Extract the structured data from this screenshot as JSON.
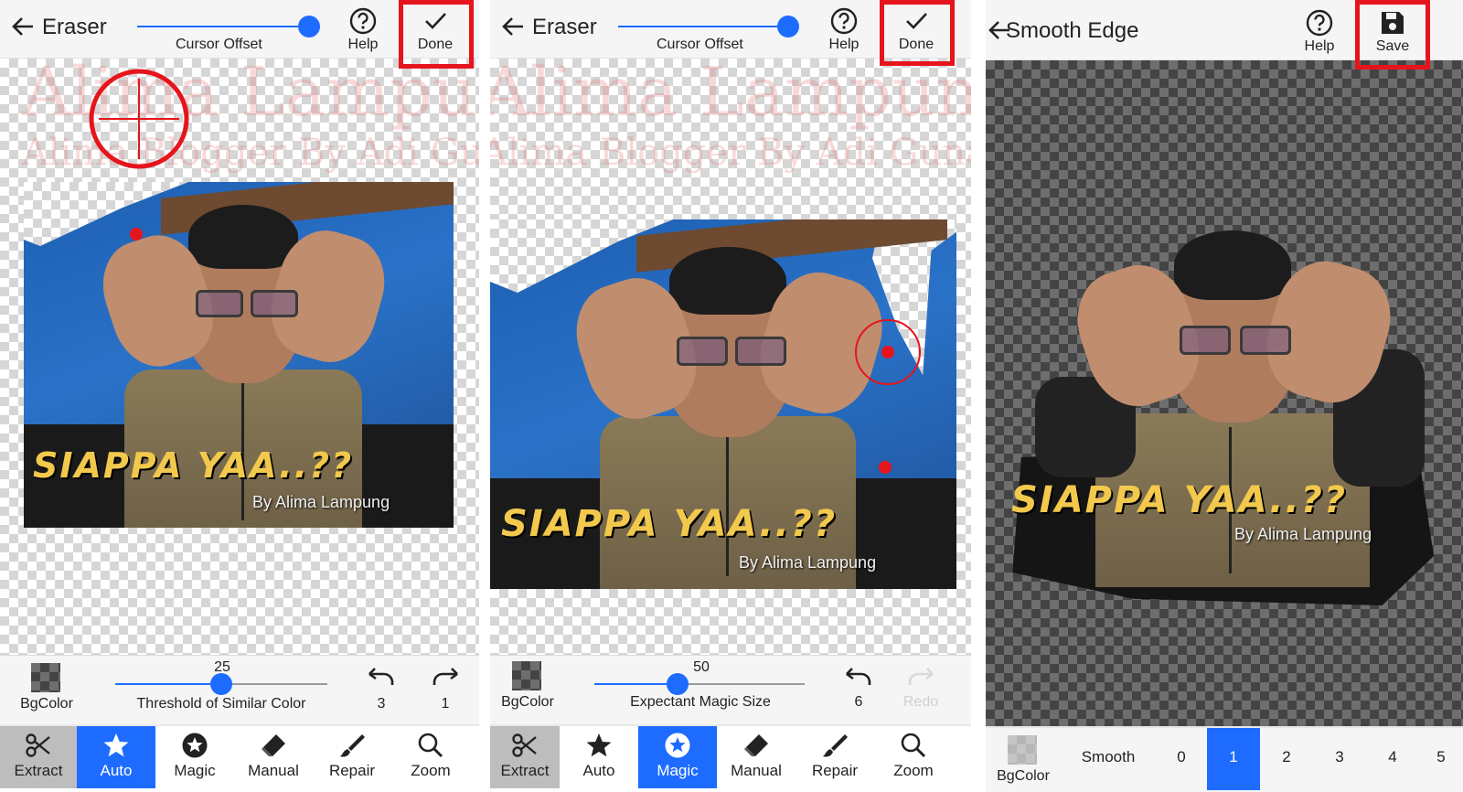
{
  "colors": {
    "accent": "#1e6cff",
    "highlight": "#e6141c",
    "toolbar_bg": "#f5f5f5"
  },
  "watermark": {
    "line1": "Alima Lampung Business",
    "line2": "Alima Blogger By Adi Gunawan"
  },
  "sticker": {
    "main": "SIAPPA YAA..??",
    "byline": "By Alima Lampung"
  },
  "panel1": {
    "title": "Eraser",
    "cursor_offset_label": "Cursor Offset",
    "help_label": "Help",
    "done_label": "Done",
    "slider_value": "25",
    "slider_label": "Threshold of Similar Color",
    "bgcolor_label": "BgColor",
    "undo_count": "3",
    "redo_count": "1",
    "tabs": [
      {
        "label": "Extract",
        "icon": "scissors-icon"
      },
      {
        "label": "Auto",
        "icon": "star-icon"
      },
      {
        "label": "Magic",
        "icon": "magic-star-icon"
      },
      {
        "label": "Manual",
        "icon": "eraser-icon"
      },
      {
        "label": "Repair",
        "icon": "brush-icon"
      },
      {
        "label": "Zoom",
        "icon": "search-icon"
      }
    ],
    "active_tab": "Auto"
  },
  "panel2": {
    "title": "Eraser",
    "cursor_offset_label": "Cursor Offset",
    "help_label": "Help",
    "done_label": "Done",
    "slider_value": "50",
    "slider_label": "Expectant Magic Size",
    "bgcolor_label": "BgColor",
    "undo_count": "6",
    "redo_label": "Redo",
    "tabs": [
      {
        "label": "Extract",
        "icon": "scissors-icon"
      },
      {
        "label": "Auto",
        "icon": "star-icon"
      },
      {
        "label": "Magic",
        "icon": "magic-star-icon"
      },
      {
        "label": "Manual",
        "icon": "eraser-icon"
      },
      {
        "label": "Repair",
        "icon": "brush-icon"
      },
      {
        "label": "Zoom",
        "icon": "search-icon"
      }
    ],
    "active_tab": "Magic"
  },
  "panel3": {
    "title": "Smooth Edge",
    "help_label": "Help",
    "save_label": "Save",
    "bgcolor_label": "BgColor",
    "smooth_label": "Smooth",
    "levels": [
      "0",
      "1",
      "2",
      "3",
      "4",
      "5"
    ],
    "selected_level": "1"
  }
}
